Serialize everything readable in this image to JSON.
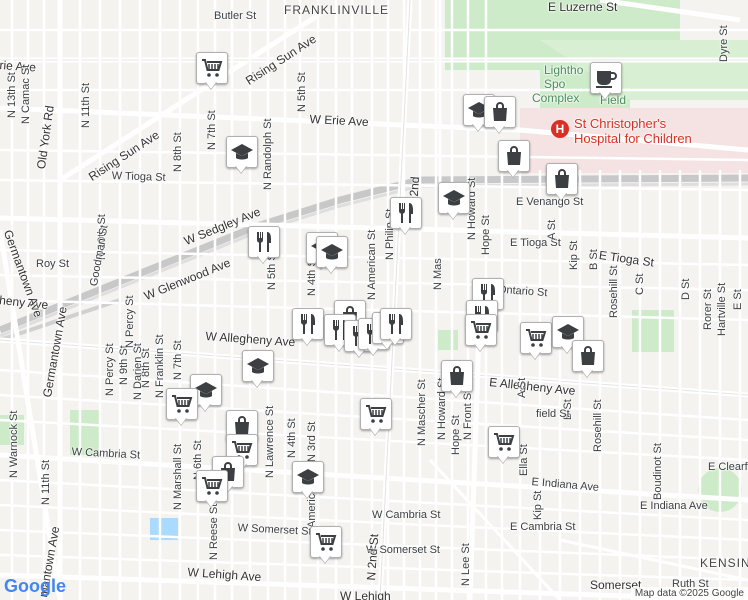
{
  "map": {
    "neighborhoods": [
      {
        "id": "franklinville",
        "text": "FRANKLINVILLE"
      },
      {
        "id": "kensington",
        "text": "KENSIN"
      }
    ],
    "pois": [
      {
        "id": "lighthouse",
        "lines": [
          "Lightho",
          "Spo",
          "Complex",
          "Field"
        ]
      },
      {
        "id": "hospital",
        "lines": [
          "St Christopher's",
          "Hospital for Children"
        ]
      }
    ],
    "streets": [
      {
        "id": "e-luzerne",
        "text": "E Luzerne St"
      },
      {
        "id": "w-erie-ave",
        "text": "W Erie Ave"
      },
      {
        "id": "rising-sun-ave-1",
        "text": "Rising Sun Ave"
      },
      {
        "id": "rising-sun-ave-2",
        "text": "Rising Sun Ave"
      },
      {
        "id": "erie-ave-left",
        "text": "rie Ave"
      },
      {
        "id": "w-tioga",
        "text": "W Tioga St"
      },
      {
        "id": "w-sedgley",
        "text": "W Sedgley Ave"
      },
      {
        "id": "w-glenwood",
        "text": "W Glenwood Ave"
      },
      {
        "id": "e-venango",
        "text": "E Venango St"
      },
      {
        "id": "e-tioga",
        "text": "E Tioga St"
      },
      {
        "id": "e-tioga-2",
        "text": "E Tioga St"
      },
      {
        "id": "e-ontario",
        "text": "E Ontario St"
      },
      {
        "id": "w-allegheny",
        "text": "W Allegheny Ave"
      },
      {
        "id": "e-allegheny",
        "text": "E Allegheny Ave"
      },
      {
        "id": "heny-ave",
        "text": "heny Ave"
      },
      {
        "id": "w-cambria",
        "text": "W Cambria St"
      },
      {
        "id": "w-cambria-2",
        "text": "W Cambria St"
      },
      {
        "id": "e-cambria",
        "text": "E Cambria St"
      },
      {
        "id": "e-indiana",
        "text": "E Indiana Ave"
      },
      {
        "id": "e-indiana-2",
        "text": "E Indiana Ave"
      },
      {
        "id": "w-somerset",
        "text": "W Somerset St"
      },
      {
        "id": "w-somerset-2",
        "text": "W Somerset St"
      },
      {
        "id": "w-lehigh",
        "text": "W Lehigh Ave"
      },
      {
        "id": "w-lehigh-2",
        "text": "W Lehigh"
      },
      {
        "id": "e-somerset",
        "text": "Somerset"
      },
      {
        "id": "ruth",
        "text": "Ruth St"
      },
      {
        "id": "e-clearf",
        "text": "E Clearf"
      },
      {
        "id": "roy",
        "text": "Roy St"
      },
      {
        "id": "germantown-1",
        "text": "Germantown Ave"
      },
      {
        "id": "germantown-2",
        "text": "Germantown Ave"
      },
      {
        "id": "germantown-3",
        "text": "mantown Ave"
      },
      {
        "id": "old-york",
        "text": "Old York Rd"
      },
      {
        "id": "n-13th",
        "text": "N 13th St"
      },
      {
        "id": "n-camac",
        "text": "N Camac St"
      },
      {
        "id": "n-11th",
        "text": "N 11th St"
      },
      {
        "id": "n-11th-2",
        "text": "N 11th St"
      },
      {
        "id": "n-10th",
        "text": "N 10th St"
      },
      {
        "id": "goodman",
        "text": "Goodman St"
      },
      {
        "id": "n-8th",
        "text": "N 8th St"
      },
      {
        "id": "n-7th",
        "text": "N 7th St"
      },
      {
        "id": "n-5th",
        "text": "N 5th St"
      },
      {
        "id": "n-5th-2",
        "text": "N 5th St"
      },
      {
        "id": "n-4th",
        "text": "N 4th St"
      },
      {
        "id": "n-4th-2",
        "text": "N 4th St"
      },
      {
        "id": "n-randolph",
        "text": "N Randolph St"
      },
      {
        "id": "n-american",
        "text": "N American St"
      },
      {
        "id": "n-american-2",
        "text": "American St"
      },
      {
        "id": "n-philip",
        "text": "N Philip St"
      },
      {
        "id": "n-2nd",
        "text": "N 2nd St"
      },
      {
        "id": "n-2nd-2",
        "text": "N 2nd"
      },
      {
        "id": "n-3rd",
        "text": "N 3rd St"
      },
      {
        "id": "n-lawrence",
        "text": "N Lawrence St"
      },
      {
        "id": "n-6th",
        "text": "N 6th St"
      },
      {
        "id": "n-reese",
        "text": "N Reese St"
      },
      {
        "id": "n-marshall",
        "text": "N Marshall St"
      },
      {
        "id": "n-franklin",
        "text": "N Franklin St"
      },
      {
        "id": "n-8th-2",
        "text": "N 8th St"
      },
      {
        "id": "n-9th",
        "text": "N 9th St"
      },
      {
        "id": "n-darien",
        "text": "N Darien St"
      },
      {
        "id": "n-percy",
        "text": "N Percy St"
      },
      {
        "id": "n-warnock",
        "text": "N Warnock St"
      },
      {
        "id": "n-7th-2",
        "text": "N 7th St"
      },
      {
        "id": "n-mascher",
        "text": "N Mascher St"
      },
      {
        "id": "n-mascher-2",
        "text": "N Mas"
      },
      {
        "id": "n-howard",
        "text": "N Howard St"
      },
      {
        "id": "n-howard-2",
        "text": "N Howard St"
      },
      {
        "id": "hope",
        "text": "Hope St"
      },
      {
        "id": "hope-2",
        "text": "Hope St"
      },
      {
        "id": "n-front",
        "text": "N Front St"
      },
      {
        "id": "n-lee",
        "text": "N Lee St"
      },
      {
        "id": "a-st",
        "text": "A St"
      },
      {
        "id": "b-st",
        "text": "B St"
      },
      {
        "id": "b-st-2",
        "text": "B St"
      },
      {
        "id": "kip",
        "text": "Kip St"
      },
      {
        "id": "kip-2",
        "text": "Kip St"
      },
      {
        "id": "rosehill",
        "text": "Rosehill St"
      },
      {
        "id": "rosehill-2",
        "text": "Rosehill St"
      },
      {
        "id": "c-st",
        "text": "C St"
      },
      {
        "id": "d-st",
        "text": "D St"
      },
      {
        "id": "rorer",
        "text": "Rorer St"
      },
      {
        "id": "hartville",
        "text": "Hartville St"
      },
      {
        "id": "e-st",
        "text": "E St"
      },
      {
        "id": "ella",
        "text": "Ella St"
      },
      {
        "id": "boudinot",
        "text": "Boudinot St"
      },
      {
        "id": "dyre",
        "text": "Dyre St"
      },
      {
        "id": "butler",
        "text": "Butler St"
      },
      {
        "id": "field",
        "text": "field St"
      },
      {
        "id": "n-percy-2",
        "text": "N Percy St"
      },
      {
        "id": "a-st-2",
        "text": "A St"
      }
    ],
    "markers": [
      {
        "id": "m1",
        "icon": "cart"
      },
      {
        "id": "m2",
        "icon": "school"
      },
      {
        "id": "m3",
        "icon": "school"
      },
      {
        "id": "m4",
        "icon": "bag"
      },
      {
        "id": "m5",
        "icon": "cafe"
      },
      {
        "id": "m6",
        "icon": "bag"
      },
      {
        "id": "m7",
        "icon": "bag"
      },
      {
        "id": "m8",
        "icon": "restaurant"
      },
      {
        "id": "m9",
        "icon": "school"
      },
      {
        "id": "m10",
        "icon": "restaurant"
      },
      {
        "id": "m11",
        "icon": "school"
      },
      {
        "id": "m12",
        "icon": "restaurant"
      },
      {
        "id": "m13",
        "icon": "school"
      },
      {
        "id": "m14",
        "icon": "bag"
      },
      {
        "id": "m15",
        "icon": "restaurant"
      },
      {
        "id": "m16",
        "icon": "restaurant"
      },
      {
        "id": "m17",
        "icon": "restaurant"
      },
      {
        "id": "m18",
        "icon": "restaurant"
      },
      {
        "id": "m19",
        "icon": "restaurant"
      },
      {
        "id": "m20",
        "icon": "restaurant"
      },
      {
        "id": "m21",
        "icon": "restaurant"
      },
      {
        "id": "m22",
        "icon": "cart"
      },
      {
        "id": "m23",
        "icon": "cart"
      },
      {
        "id": "m24",
        "icon": "school"
      },
      {
        "id": "m25",
        "icon": "bag"
      },
      {
        "id": "m26",
        "icon": "bag"
      },
      {
        "id": "m27",
        "icon": "school"
      },
      {
        "id": "m28",
        "icon": "cart"
      },
      {
        "id": "m29",
        "icon": "school"
      },
      {
        "id": "m30",
        "icon": "cart"
      },
      {
        "id": "m31",
        "icon": "bag"
      },
      {
        "id": "m32",
        "icon": "cart"
      },
      {
        "id": "m33",
        "icon": "bag"
      },
      {
        "id": "m34",
        "icon": "cart"
      },
      {
        "id": "m35",
        "icon": "school"
      },
      {
        "id": "m36",
        "icon": "cart"
      },
      {
        "id": "m37",
        "icon": "cart"
      }
    ],
    "hospital_symbol": "H",
    "google_logo": "Google",
    "attribution": "Map data ©2025 Google",
    "colors": {
      "background": "#f4f3f0",
      "park": "#cdebc8",
      "street": "#ffffff",
      "major": "#e8e8e8",
      "rail": "#bdbdbd",
      "water": "#aadaff",
      "icon": "#3c4043"
    }
  }
}
